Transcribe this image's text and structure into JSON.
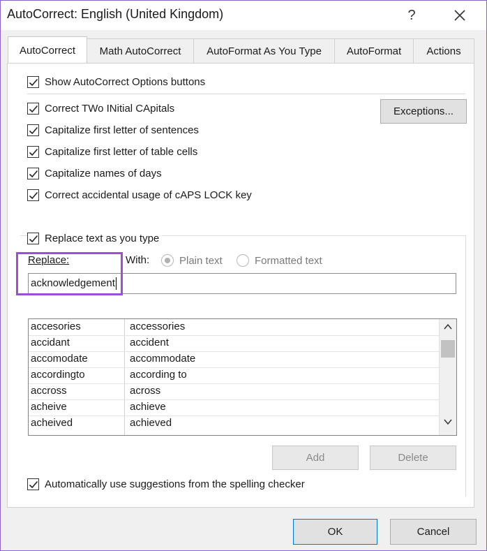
{
  "window": {
    "title": "AutoCorrect: English (United Kingdom)",
    "help_glyph": "?"
  },
  "tabs": [
    {
      "label": "AutoCorrect"
    },
    {
      "label": "Math AutoCorrect"
    },
    {
      "label": "AutoFormat As You Type"
    },
    {
      "label": "AutoFormat"
    },
    {
      "label": "Actions"
    }
  ],
  "options": {
    "show_buttons": "Show AutoCorrect Options buttons",
    "two_initial": "Correct TWo INitial CApitals",
    "first_letter": "Capitalize first letter of sentences",
    "table_cells": "Capitalize first letter of table cells",
    "days": "Capitalize names of days",
    "caps_lock": "Correct accidental usage of cAPS LOCK key",
    "replace_as_type": "Replace text as you type",
    "spelling": "Automatically use suggestions from the spelling checker"
  },
  "exceptions_label": "Exceptions...",
  "replace": {
    "replace_label": "Replace:",
    "with_label": "With:",
    "plain_text": "Plain text",
    "formatted_text": "Formatted text",
    "replace_value": "acknowledgement",
    "with_value": ""
  },
  "list": [
    {
      "from": "accesories",
      "to": "accessories"
    },
    {
      "from": "accidant",
      "to": "accident"
    },
    {
      "from": "accomodate",
      "to": "accommodate"
    },
    {
      "from": "accordingto",
      "to": "according to"
    },
    {
      "from": "accross",
      "to": "across"
    },
    {
      "from": "acheive",
      "to": "achieve"
    },
    {
      "from": "acheived",
      "to": "achieved"
    }
  ],
  "buttons": {
    "add": "Add",
    "delete": "Delete",
    "ok": "OK",
    "cancel": "Cancel"
  },
  "colors": {
    "highlight": "#9b4fd8",
    "window_border": "#8a63c8"
  }
}
